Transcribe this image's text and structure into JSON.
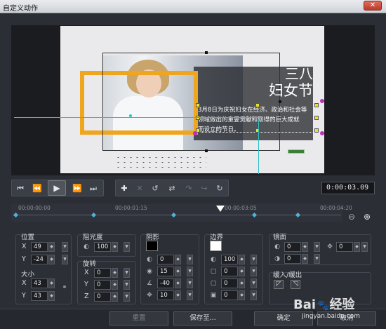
{
  "window": {
    "title": "自定义动作",
    "close_glyph": "✕"
  },
  "preview": {
    "headline_line1": "三八",
    "headline_line2": "妇女节",
    "body_line1": "3月8日为庆祝妇女在经济、政治和社会等",
    "body_line2": "领域做出的重要贡献和取得的巨大成就",
    "body_line3": "而设立的节日。"
  },
  "transport": {
    "timecode": "0:00:03.09"
  },
  "timeline": {
    "ruler_labels": [
      "00:00:00:00",
      "00:00:01:15",
      "00:00:03:05",
      "00:00:04:20"
    ]
  },
  "position": {
    "label": "位置",
    "x_label": "X",
    "x_value": "49",
    "y_label": "Y",
    "y_value": "-24"
  },
  "size": {
    "label": "大小",
    "x_label": "X",
    "x_value": "43",
    "y_label": "Y",
    "y_value": "43"
  },
  "opacity": {
    "label": "阻光度",
    "value": "100"
  },
  "rotation": {
    "label": "旋转",
    "x_label": "X",
    "x_value": "0",
    "y_label": "Y",
    "y_value": "0",
    "z_label": "Z",
    "z_value": "0"
  },
  "shadow": {
    "label": "阴影",
    "color": "#000000",
    "value1": "0",
    "value2": "15",
    "value3": "-40",
    "value4": "10"
  },
  "border": {
    "label": "边界",
    "color": "#ffffff",
    "value1": "100",
    "value2": "0",
    "value3": "0",
    "value4": "0"
  },
  "mirror": {
    "label": "镜面",
    "value1": "0",
    "value2": "0",
    "value3": "0"
  },
  "ease": {
    "label": "缓入/缓出"
  },
  "footer": {
    "reset": "重置",
    "save_as": "保存至...",
    "ok": "确定",
    "cancel": "取消"
  },
  "watermark": {
    "brand": "Bai",
    "brand2": "经验",
    "url": "jingyan.baidu.com"
  }
}
